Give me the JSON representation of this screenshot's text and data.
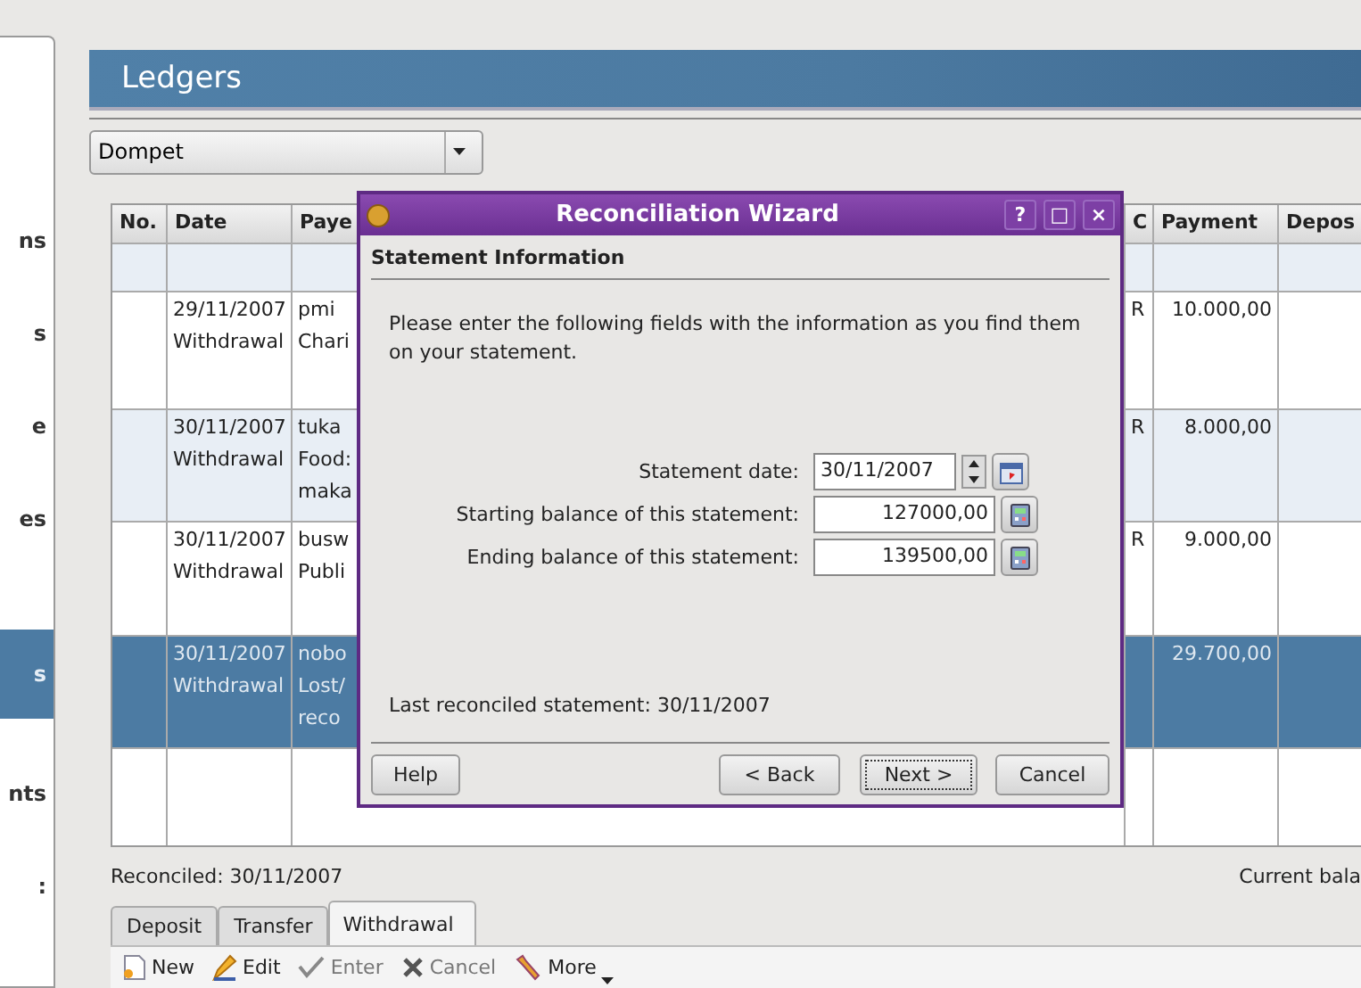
{
  "sidebar": {
    "items": [
      {
        "label": "ns",
        "selected": false
      },
      {
        "label": "s",
        "selected": false
      },
      {
        "label": "e",
        "selected": false
      },
      {
        "label": "es",
        "selected": false
      },
      {
        "label": "s",
        "selected": true
      },
      {
        "label": "nts",
        "selected": false
      },
      {
        "label": ":",
        "selected": false
      }
    ]
  },
  "header": {
    "title": "Ledgers"
  },
  "account_select": {
    "value": "Dompet"
  },
  "table": {
    "columns": [
      "No.",
      "Date",
      "Paye",
      "C",
      "Payment",
      "Depos"
    ],
    "rows": [
      {
        "no": "",
        "date": "29/11/2007",
        "type": "Withdrawal",
        "payee": [
          "pmi",
          "Chari"
        ],
        "c": "R",
        "payment": "10.000,00",
        "deposit": "",
        "selected": false
      },
      {
        "no": "",
        "date": "30/11/2007",
        "type": "Withdrawal",
        "payee": [
          "tuka",
          "Food:",
          "maka"
        ],
        "c": "R",
        "payment": "8.000,00",
        "deposit": "",
        "selected": false
      },
      {
        "no": "",
        "date": "30/11/2007",
        "type": "Withdrawal",
        "payee": [
          "busw",
          "Publi"
        ],
        "c": "R",
        "payment": "9.000,00",
        "deposit": "",
        "selected": false
      },
      {
        "no": "",
        "date": "30/11/2007",
        "type": "Withdrawal",
        "payee": [
          "nobo",
          "Lost/",
          "reco"
        ],
        "c": "",
        "payment": "29.700,00",
        "deposit": "",
        "selected": true
      }
    ]
  },
  "reconciled": "Reconciled: 30/11/2007",
  "current_balance": "Current bala",
  "tabs": [
    {
      "label": "Deposit",
      "selected": false
    },
    {
      "label": "Transfer",
      "selected": false
    },
    {
      "label": "Withdrawal",
      "selected": true
    }
  ],
  "toolbar": [
    {
      "kind": "new",
      "label": "New",
      "disabled": false
    },
    {
      "kind": "edit",
      "label": "Edit",
      "disabled": false
    },
    {
      "kind": "enter",
      "label": "Enter",
      "disabled": true
    },
    {
      "kind": "cancel",
      "label": "Cancel",
      "disabled": true
    },
    {
      "kind": "more",
      "label": "More",
      "disabled": false
    }
  ],
  "dialog": {
    "title": "Reconciliation Wizard",
    "title_buttons": [
      "?",
      "□",
      "×"
    ],
    "heading": "Statement Information",
    "intro": "Please enter the following fields with the information as you find them on your statement.",
    "fields": [
      {
        "kind": "date",
        "label": "Statement date:",
        "value": "30/11/2007"
      },
      {
        "kind": "amount",
        "label": "Starting balance of this statement:",
        "value": "127000,00"
      },
      {
        "kind": "amount",
        "label": "Ending balance of this statement:",
        "value": "139500,00"
      }
    ],
    "last_reconciled": "Last reconciled statement: 30/11/2007",
    "buttons": [
      {
        "kind": "help",
        "label": "Help",
        "focused": false
      },
      {
        "kind": "back",
        "label": "< Back",
        "focused": false
      },
      {
        "kind": "next",
        "label": "Next >",
        "focused": true
      },
      {
        "kind": "cancel",
        "label": "Cancel",
        "focused": false
      }
    ]
  }
}
